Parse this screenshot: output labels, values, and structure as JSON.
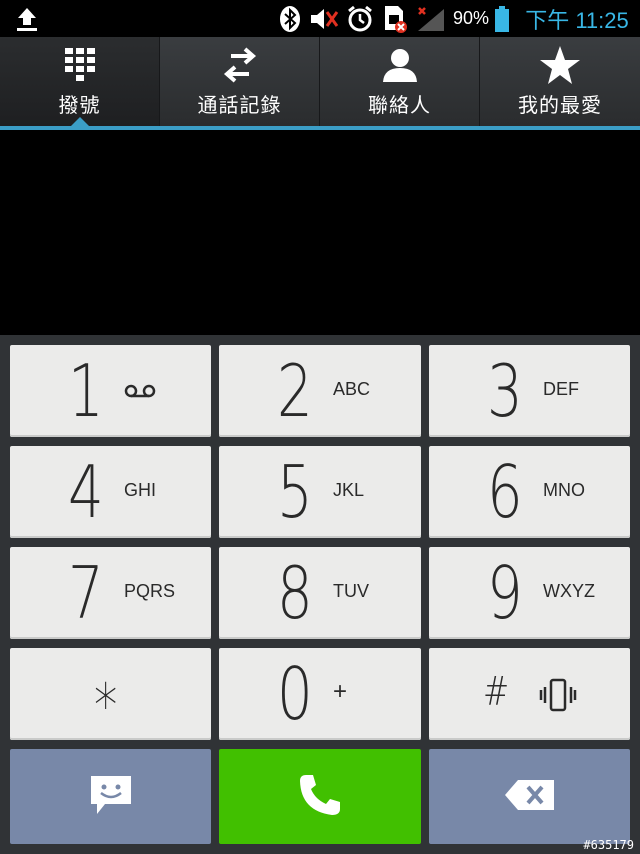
{
  "status_bar": {
    "battery_percent": "90%",
    "time": "下午 11:25",
    "icons": [
      "upload-icon",
      "bluetooth-icon",
      "volume-muted-icon",
      "alarm-icon",
      "sim-error-icon",
      "signal-none-icon",
      "battery-icon"
    ]
  },
  "tabs": [
    {
      "label": "撥號",
      "icon": "dialpad-icon",
      "active": true
    },
    {
      "label": "通話記錄",
      "icon": "call-log-icon",
      "active": false
    },
    {
      "label": "聯絡人",
      "icon": "contact-icon",
      "active": false
    },
    {
      "label": "我的最愛",
      "icon": "star-icon",
      "active": false
    }
  ],
  "display": {
    "number": ""
  },
  "keypad": {
    "keys": [
      {
        "digit": "1",
        "letters": "",
        "icon": "voicemail-icon"
      },
      {
        "digit": "2",
        "letters": "ABC"
      },
      {
        "digit": "3",
        "letters": "DEF"
      },
      {
        "digit": "4",
        "letters": "GHI"
      },
      {
        "digit": "5",
        "letters": "JKL"
      },
      {
        "digit": "6",
        "letters": "MNO"
      },
      {
        "digit": "7",
        "letters": "PQRS"
      },
      {
        "digit": "8",
        "letters": "TUV"
      },
      {
        "digit": "9",
        "letters": "WXYZ"
      },
      {
        "digit": "*",
        "letters": ""
      },
      {
        "digit": "0",
        "letters": "+"
      },
      {
        "digit": "#",
        "letters": "",
        "icon": "vibrate-icon"
      }
    ],
    "bottom": [
      {
        "name": "message-button",
        "icon": "message-icon",
        "color": "#7888a8"
      },
      {
        "name": "call-button",
        "icon": "phone-icon",
        "color": "#41c000"
      },
      {
        "name": "delete-button",
        "icon": "backspace-icon",
        "color": "#7888a8"
      }
    ]
  },
  "watermark": "#635179",
  "colors": {
    "accent": "#3b9ec7",
    "clock": "#39b7e6",
    "call": "#41c000",
    "side_keys": "#7888a8"
  }
}
